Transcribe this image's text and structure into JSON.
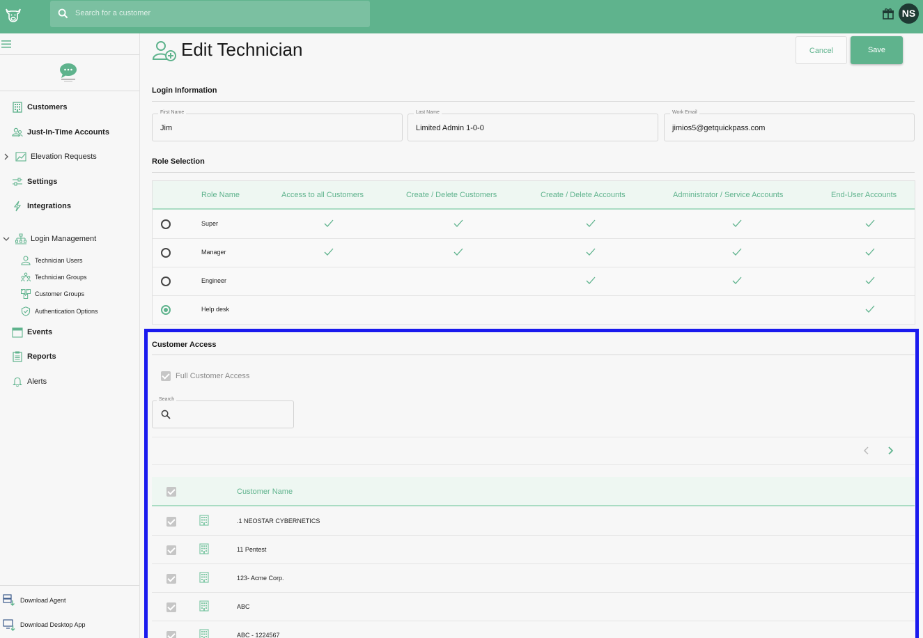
{
  "app": {
    "search_placeholder": "Search for a customer",
    "avatar_initials": "NS",
    "accent_color": "#5fb38d",
    "header_bg": "#5fb38d"
  },
  "sidebar": {
    "items": [
      {
        "label": "Customers",
        "icon": "building-icon"
      },
      {
        "label": "Just-In-Time Accounts",
        "icon": "users-icon"
      },
      {
        "label": "Elevation Requests",
        "icon": "chart-icon"
      },
      {
        "label": "Settings",
        "icon": "sliders-icon"
      },
      {
        "label": "Integrations",
        "icon": "lightning-icon"
      },
      {
        "label": "Login Management",
        "icon": "sitemap-icon"
      }
    ],
    "sub_items": [
      {
        "label": "Technician Users",
        "icon": "user-icon"
      },
      {
        "label": "Technician Groups",
        "icon": "users-group-icon"
      },
      {
        "label": "Customer Groups",
        "icon": "buildings-icon"
      },
      {
        "label": "Authentication Options",
        "icon": "shield-icon"
      }
    ],
    "lower_items": [
      {
        "label": "Events",
        "icon": "calendar-icon"
      },
      {
        "label": "Reports",
        "icon": "clipboard-icon"
      },
      {
        "label": "Alerts",
        "icon": "bell-icon"
      }
    ],
    "bottom_items": [
      {
        "label": "Download Agent",
        "icon": "server-download-icon"
      },
      {
        "label": "Download Desktop App",
        "icon": "monitor-download-icon"
      }
    ]
  },
  "page": {
    "title": "Edit Technician",
    "cancel_label": "Cancel",
    "save_label": "Save"
  },
  "login_info": {
    "section_title": "Login Information",
    "first_name_label": "First Name",
    "first_name": "Jim",
    "last_name_label": "Last Name",
    "last_name": "Limited Admin 1-0-0",
    "email_label": "Work Email",
    "email": "jimios5@getquickpass.com"
  },
  "role_selection": {
    "section_title": "Role Selection",
    "columns": [
      "Role Name",
      "Access to all Customers",
      "Create / Delete Customers",
      "Create / Delete Accounts",
      "Administrator / Service Accounts",
      "End-User Accounts"
    ],
    "rows": [
      {
        "name": "Super",
        "selected": false,
        "perms": [
          true,
          true,
          true,
          true,
          true
        ]
      },
      {
        "name": "Manager",
        "selected": false,
        "perms": [
          true,
          true,
          true,
          true,
          true
        ]
      },
      {
        "name": "Engineer",
        "selected": false,
        "perms": [
          false,
          false,
          true,
          true,
          true
        ]
      },
      {
        "name": "Help desk",
        "selected": true,
        "perms": [
          false,
          false,
          false,
          false,
          true
        ]
      }
    ]
  },
  "customer_access": {
    "section_title": "Customer Access",
    "full_access_label": "Full Customer Access",
    "full_access_checked": true,
    "search_label": "Search",
    "column_header": "Customer Name",
    "customers": [
      ".1 NEOSTAR CYBERNETICS",
      "11 Pentest",
      "123- Acme Corp.",
      "ABC",
      "ABC - 1224567"
    ]
  }
}
